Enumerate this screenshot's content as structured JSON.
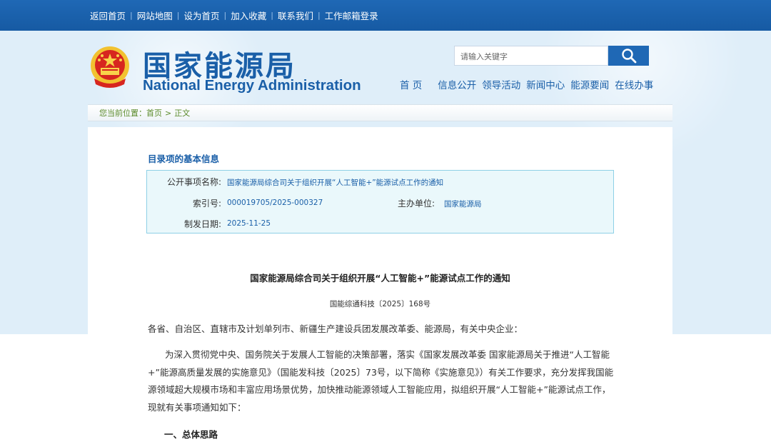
{
  "topnav": {
    "links": [
      "返回首页",
      "网站地图",
      "设为首页",
      "加入收藏",
      "联系我们",
      "工作邮箱登录"
    ],
    "separator": "|"
  },
  "brand": {
    "cn": "国家能源局",
    "en": "National Energy Administration"
  },
  "search": {
    "placeholder": "请输入关键字"
  },
  "mainnav": [
    "首 页",
    "信息公开",
    "领导活动",
    "新闻中心",
    "能源要闻",
    "在线办事"
  ],
  "breadcrumb": {
    "prefix": "您当前位置：",
    "home": "首页",
    "sep": ">",
    "current": "正文"
  },
  "catalog": {
    "title": "目录项的基本信息",
    "item_name_label": "公开事项名称:",
    "item_name_value": "国家能源局综合司关于组织开展“人工智能+”能源试点工作的通知",
    "index_label": "索引号:",
    "index_value": "000019705/2025-000327",
    "unit_label": "主办单位:",
    "unit_value": "国家能源局",
    "date_label": "制发日期:",
    "date_value": "2025-11-25"
  },
  "document": {
    "title": "国家能源局综合司关于组织开展“人工智能+”能源试点工作的通知",
    "number": "国能综通科技〔2025〕168号",
    "recipients": "各省、自治区、直辖市及计划单列市、新疆生产建设兵团发展改革委、能源局，有关中央企业：",
    "body": "为深入贯彻党中央、国务院关于发展人工智能的决策部署，落实《国家发展改革委 国家能源局关于推进“人工智能+”能源高质量发展的实施意见》（国能发科技〔2025〕73号，以下简称《实施意见》）有关工作要求，充分发挥我国能源领域超大规模市场和丰富应用场景优势，加快推动能源领域人工智能应用，拟组织开展“人工智能+”能源试点工作，现就有关事项通知如下：",
    "section1": "一、总体思路"
  },
  "colors": {
    "brand_blue": "#1a5fa8",
    "topbar": "#1f68b5",
    "breadcrumb_green": "#5a8a2a",
    "infobox_bg": "#eaf8fb",
    "infobox_border": "#8ed0e6"
  }
}
